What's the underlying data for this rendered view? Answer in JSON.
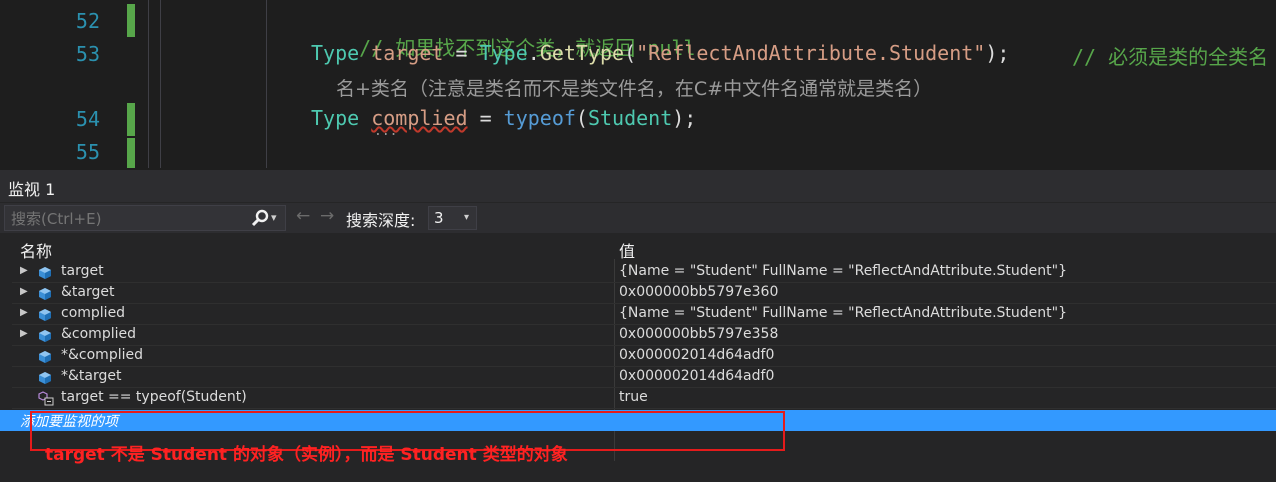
{
  "editor": {
    "lines": [
      {
        "num": "52"
      },
      {
        "num": "53"
      },
      {
        "num": "54"
      },
      {
        "num": "55"
      }
    ],
    "line52": {
      "comment": "// 如果找不到这个类，就返回 null"
    },
    "line53": {
      "type_kw": "Type",
      "var": "target",
      "eq": " = ",
      "type2": "Type",
      "dot": ".",
      "method": "GetType",
      "paren_open": "(",
      "str": "\"ReflectAndAttribute.Student\"",
      "paren_close": ")",
      "semi": ";",
      "comment": "// 必须是类的全类名",
      "wrap": "名+类名（注意是类名而不是类文件名，在C#中文件名通常就是类名）"
    },
    "line54": {
      "type_kw": "Type",
      "var": "complied",
      "eq": " = ",
      "kw": "typeof",
      "paren_open": "(",
      "cls": "Student",
      "paren_close": ");"
    },
    "ellipsis": "..."
  },
  "watch": {
    "title": "监视 1",
    "search_placeholder": "搜索(Ctrl+E)",
    "depth_label": "搜索深度:",
    "depth_value": "3",
    "columns": {
      "name": "名称",
      "value": "值"
    },
    "rows": [
      {
        "name": "target",
        "value": "{Name = \"Student\" FullName = \"ReflectAndAttribute.Student\"}",
        "expandable": true,
        "icon": "cube-icon"
      },
      {
        "name": "&target",
        "value": "0x000000bb5797e360",
        "expandable": true,
        "icon": "cube-icon"
      },
      {
        "name": "complied",
        "value": "{Name = \"Student\" FullName = \"ReflectAndAttribute.Student\"}",
        "expandable": true,
        "icon": "cube-icon"
      },
      {
        "name": "&complied",
        "value": "0x000000bb5797e358",
        "expandable": true,
        "icon": "cube-icon"
      },
      {
        "name": "*&complied",
        "value": "0x000002014d64adf0",
        "expandable": false,
        "icon": "cube-icon"
      },
      {
        "name": "*&target",
        "value": "0x000002014d64adf0",
        "expandable": false,
        "icon": "cube-icon"
      },
      {
        "name": "target == typeof(Student)",
        "value": "true",
        "expandable": false,
        "icon": "bool-field-icon"
      }
    ],
    "add_item": "添加要监视的项"
  },
  "annotation": {
    "note": "target 不是 Student 的对象（实例），而是 Student 类型的对象"
  },
  "colors": {
    "accent": "#3399ff",
    "highlight_border": "#e51b1b",
    "note_text": "#ff2222"
  }
}
